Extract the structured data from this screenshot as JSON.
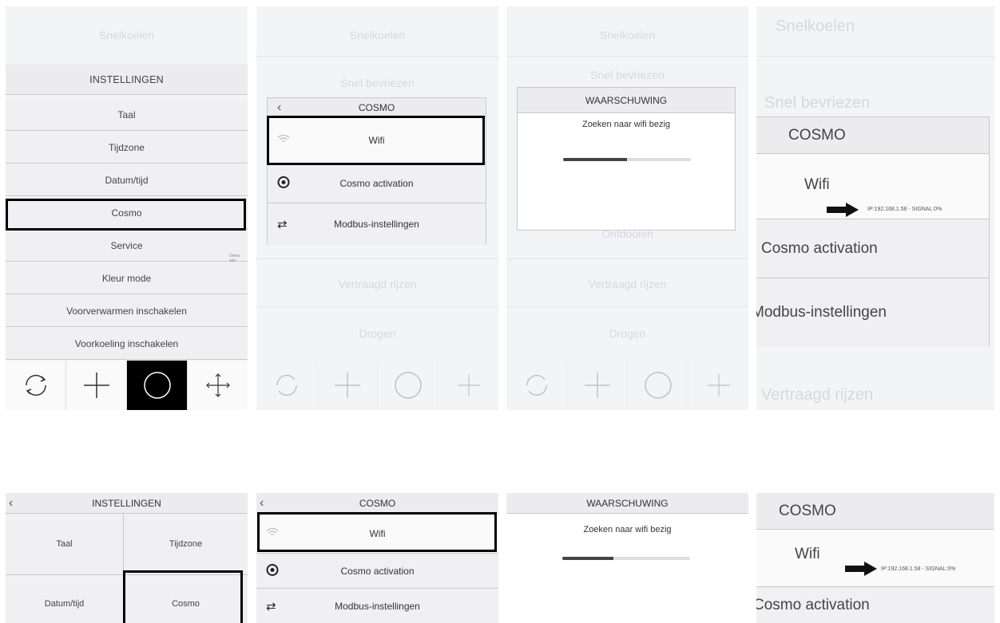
{
  "panel1": {
    "faded_top": "Snelkoelen",
    "header": "INSTELLINGEN",
    "items": [
      "Taal",
      "Tijdzone",
      "Datum/tijd",
      "Cosmo",
      "Service",
      "Kleur mode",
      "Voorverwarmen inschakelen",
      "Voorkoeling inschakelen"
    ],
    "demo_label": "Demo aan",
    "toolbar_icons": [
      "refresh-icon",
      "plus-icon",
      "circle-icon",
      "move-icon"
    ]
  },
  "panel2": {
    "faded": [
      "Snelkoelen",
      "Snel bevriezen",
      "Vertraagd rijzen",
      "Drogen"
    ],
    "header": "COSMO",
    "items": [
      "Wifi",
      "Cosmo activation",
      "Modbus-instellingen"
    ]
  },
  "panel3": {
    "faded": [
      "Snelkoelen",
      "Snel bevriezen",
      "Ontdooien",
      "Vertraagd rijzen",
      "Drogen"
    ],
    "dialog_title": "WAARSCHUWING",
    "dialog_message": "Zoeken naar wifi bezig",
    "progress": 0.5
  },
  "panel4": {
    "faded": [
      "Snelkoelen",
      "Snel bevriezen",
      "Vertraagd rijzen"
    ],
    "header": "COSMO",
    "items": [
      "Wifi",
      "Cosmo activation",
      "Modbus-instellingen"
    ],
    "ip_info": "IP:192.168.1.58 - SIGNAL:0%"
  },
  "panel5": {
    "header": "INSTELLINGEN",
    "cells": [
      "Taal",
      "Tijdzone",
      "Datum/tijd",
      "Cosmo"
    ]
  },
  "panel6": {
    "header": "COSMO",
    "items": [
      "Wifi",
      "Cosmo activation",
      "Modbus-instellingen"
    ]
  },
  "panel7": {
    "dialog_title": "WAARSCHUWING",
    "dialog_message": "Zoeken naar wifi bezig",
    "progress": 0.4
  },
  "panel8": {
    "header": "COSMO",
    "items": [
      "Wifi",
      "Cosmo activation"
    ],
    "ip_info": "IP:192.168.1.58 - SIGNAL:0%"
  }
}
